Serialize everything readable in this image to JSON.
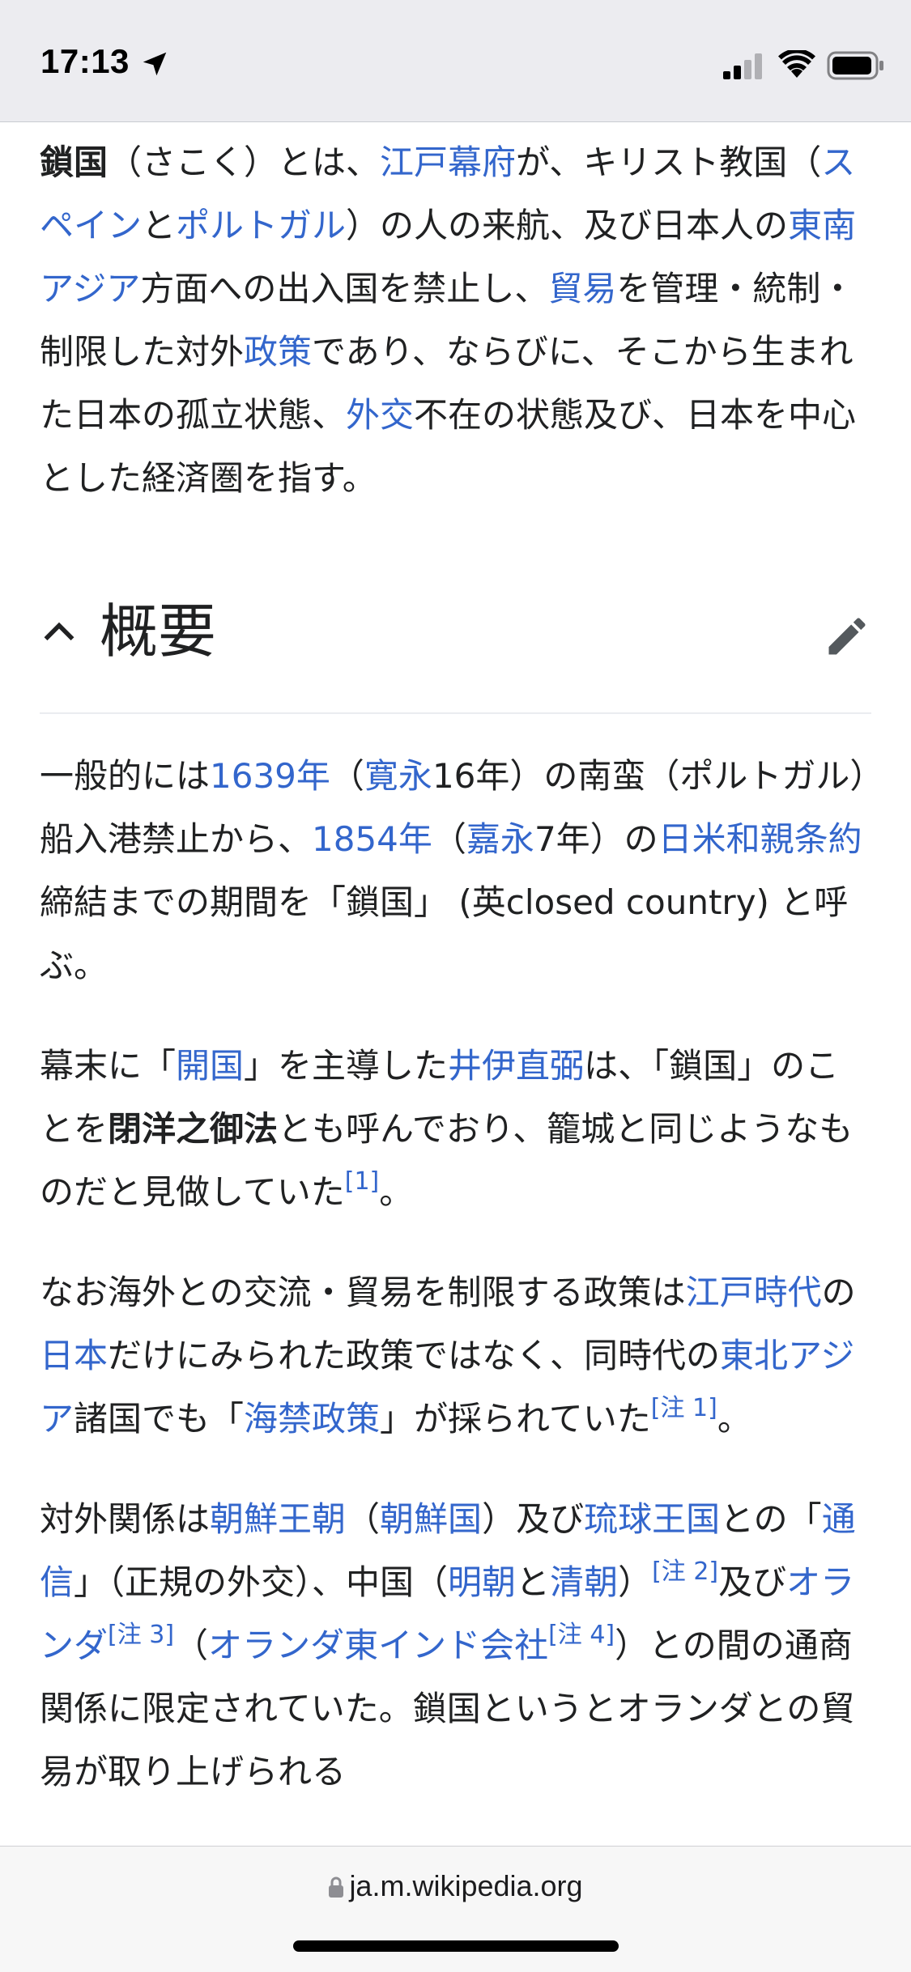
{
  "status_bar": {
    "time": "17:13"
  },
  "article": {
    "intro": [
      {
        "t": "鎖国",
        "b": true
      },
      {
        "t": "（さこく）とは、"
      },
      {
        "t": "江戸幕府",
        "link": true
      },
      {
        "t": "が、キリスト教国（"
      },
      {
        "t": "スペイン",
        "link": true
      },
      {
        "t": "と"
      },
      {
        "t": "ポルトガル",
        "link": true
      },
      {
        "t": "）の人の来航、及び日本人の"
      },
      {
        "t": "東南アジア",
        "link": true
      },
      {
        "t": "方面への出入国を禁止し、"
      },
      {
        "t": "貿易",
        "link": true
      },
      {
        "t": "を管理・統制・制限した対外"
      },
      {
        "t": "政策",
        "link": true
      },
      {
        "t": "であり、ならびに、そこから生まれた日本の孤立状態、"
      },
      {
        "t": "外交",
        "link": true
      },
      {
        "t": "不在の状態及び、日本を中心とした経済圏を指す。"
      }
    ],
    "section": {
      "title": "概要"
    },
    "paragraphs": [
      [
        {
          "t": "一般的には"
        },
        {
          "t": "1639年",
          "link": true
        },
        {
          "t": "（"
        },
        {
          "t": "寛永",
          "link": true
        },
        {
          "t": "16年）の南蛮（ポルトガル）船入港禁止から、"
        },
        {
          "t": "1854年",
          "link": true
        },
        {
          "t": "（"
        },
        {
          "t": "嘉永",
          "link": true
        },
        {
          "t": "7年）の"
        },
        {
          "t": "日米和親条約",
          "link": true
        },
        {
          "t": "締結までの期間を「鎖国」 (英closed country) と呼ぶ。"
        }
      ],
      [
        {
          "t": "幕末に「"
        },
        {
          "t": "開国",
          "link": true
        },
        {
          "t": "」を主導した"
        },
        {
          "t": "井伊直弼",
          "link": true
        },
        {
          "t": "は、「鎖国」のことを"
        },
        {
          "t": "閉洋之御法",
          "b": true
        },
        {
          "t": "とも呼んでおり、籠城と同じようなものだと見做していた"
        },
        {
          "t": "[1]",
          "sup": true
        },
        {
          "t": "。"
        }
      ],
      [
        {
          "t": "なお海外との交流・貿易を制限する政策は"
        },
        {
          "t": "江戸時代",
          "link": true
        },
        {
          "t": "の"
        },
        {
          "t": "日本",
          "link": true
        },
        {
          "t": "だけにみられた政策ではなく、同時代の"
        },
        {
          "t": "東北アジア",
          "link": true
        },
        {
          "t": "諸国でも「"
        },
        {
          "t": "海禁政策",
          "link": true
        },
        {
          "t": "」が採られていた"
        },
        {
          "t": "[注 1]",
          "sup": true
        },
        {
          "t": "。"
        }
      ],
      [
        {
          "t": "対外関係は"
        },
        {
          "t": "朝鮮王朝",
          "link": true
        },
        {
          "t": "（"
        },
        {
          "t": "朝鮮国",
          "link": true
        },
        {
          "t": "）及び"
        },
        {
          "t": "琉球王国",
          "link": true
        },
        {
          "t": "との「"
        },
        {
          "t": "通信",
          "link": true
        },
        {
          "t": "」（正規の外交）、中国（"
        },
        {
          "t": "明朝",
          "link": true
        },
        {
          "t": "と"
        },
        {
          "t": "清朝",
          "link": true
        },
        {
          "t": "）"
        },
        {
          "t": "[注 2]",
          "sup": true
        },
        {
          "t": "及び"
        },
        {
          "t": "オランダ",
          "link": true
        },
        {
          "t": "[注 3]",
          "sup": true
        },
        {
          "t": "（"
        },
        {
          "t": "オランダ東インド会社",
          "link": true
        },
        {
          "t": "[注 4]",
          "sup": true
        },
        {
          "t": "）との間の通商関係に限定されていた。鎖国というとオランダとの貿易が取り上げられる"
        }
      ]
    ]
  },
  "browser": {
    "url": "ja.m.wikipedia.org"
  },
  "colors": {
    "link": "#3366cc",
    "text": "#202122",
    "status_bar_bg": "#ececf0"
  },
  "icons": {
    "location": "location-arrow-icon",
    "signal": "cellular-signal-icon",
    "wifi": "wifi-icon",
    "battery": "battery-icon",
    "section_toggle": "chevron-up-icon",
    "edit": "pencil-icon",
    "lock": "lock-icon"
  }
}
